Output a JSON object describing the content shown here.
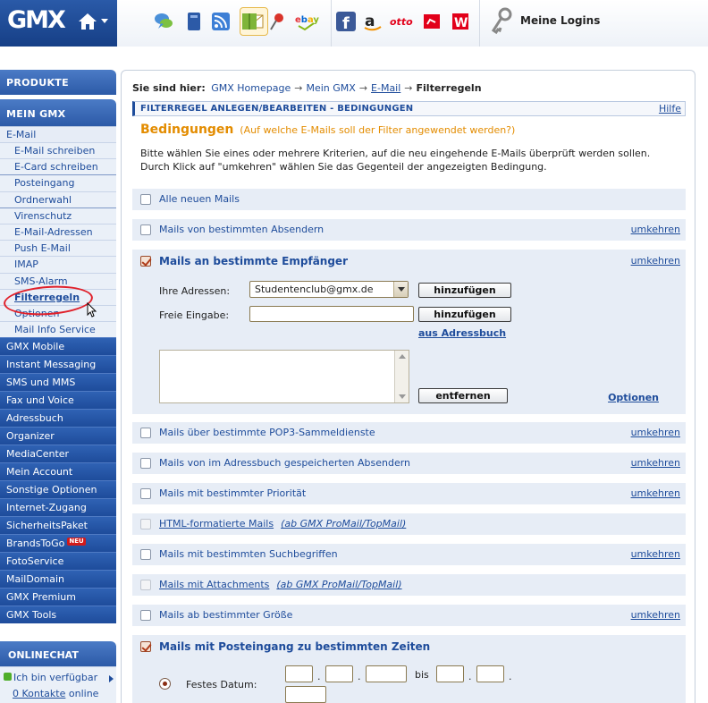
{
  "header": {
    "logo": "GMX",
    "logins_label": "Meine Logins",
    "icons": [
      "home-icon",
      "mail-icon",
      "chat-icon",
      "address-book-icon",
      "rss-icon",
      "notes-icon",
      "pin-icon",
      "ebay-icon",
      "facebook-icon",
      "amazon-icon",
      "otto-icon",
      "redirect-icon",
      "w-icon",
      "keys-icon"
    ]
  },
  "sidebar": {
    "products": "PRODUKTE",
    "mein_gmx": "MEIN GMX",
    "email_head": "E-Mail",
    "email_sub": [
      "E-Mail schreiben",
      "E-Card schreiben",
      "Posteingang",
      "Ordnerwahl",
      "Virenschutz",
      "E-Mail-Adressen",
      "Push E-Mail",
      "IMAP",
      "SMS-Alarm",
      "Filterregeln",
      "Optionen",
      "Mail Info Service"
    ],
    "items": [
      "GMX Mobile",
      "Instant Messaging",
      "SMS und MMS",
      "Fax und Voice",
      "Adressbuch",
      "Organizer",
      "MediaCenter",
      "Mein Account",
      "Sonstige Optionen",
      "Internet-Zugang",
      "SicherheitsPaket",
      "BrandsToGo",
      "FotoService",
      "MailDomain",
      "GMX Premium",
      "GMX Tools"
    ],
    "neu_badge": "NEU",
    "onlinechat": "ONLINECHAT",
    "chat_status": "Ich bin verfügbar",
    "chat_contacts_count": "0",
    "chat_contacts_link": "Kontakte",
    "chat_contacts_suffix": "online"
  },
  "main": {
    "breadcrumb_label": "Sie sind hier:",
    "breadcrumb": [
      "GMX Homepage",
      "Mein GMX",
      "E-Mail"
    ],
    "breadcrumb_current": "Filterregeln",
    "section_title": "FILTERREGEL ANLEGEN/BEARBEITEN - BEDINGUNGEN",
    "help": "Hilfe",
    "heading": "Bedingungen",
    "heading_note": "(Auf welche E-Mails soll der Filter angewendet werden?)",
    "intro_1": "Bitte wählen Sie eines oder mehrere Kriterien, auf die neu eingehende E-Mails überprüft werden sollen.",
    "intro_2": "Durch Klick auf \"umkehren\" wählen Sie das Gegenteil der angezeigten Bedingung.",
    "invert": "umkehren",
    "rows": {
      "r1": "Alle neuen Mails",
      "r2": "Mails von bestimmten Absendern",
      "r3": "Mails an bestimmte Empfänger",
      "r4": "Mails über bestimmte POP3-Sammeldienste",
      "r5": "Mails von im Adressbuch gespeicherten Absendern",
      "r6": "Mails mit bestimmter Priorität",
      "r7": "HTML-formatierte Mails",
      "r7_note": "(ab GMX ProMail/TopMail)",
      "r8": "Mails mit bestimmten Suchbegriffen",
      "r9": "Mails mit Attachments",
      "r9_note": "(ab GMX ProMail/TopMail)",
      "r10": "Mails ab bestimmter Größe",
      "r11": "Mails mit Posteingang zu bestimmten Zeiten"
    },
    "recipients": {
      "own_label": "Ihre Adressen:",
      "own_value": "Studentenclub@gmx.de",
      "free_label": "Freie Eingabe:",
      "add": "hinzufügen",
      "from_addressbook": "aus Adressbuch",
      "remove": "entfernen",
      "options": "Optionen"
    },
    "date": {
      "fixed_label": "Festes Datum:",
      "bis": "bis",
      "sep": "."
    }
  },
  "colors": {
    "brand_blue": "#1e4c9b",
    "accent_orange": "#e38c00",
    "row_bg": "#e7edf6"
  }
}
